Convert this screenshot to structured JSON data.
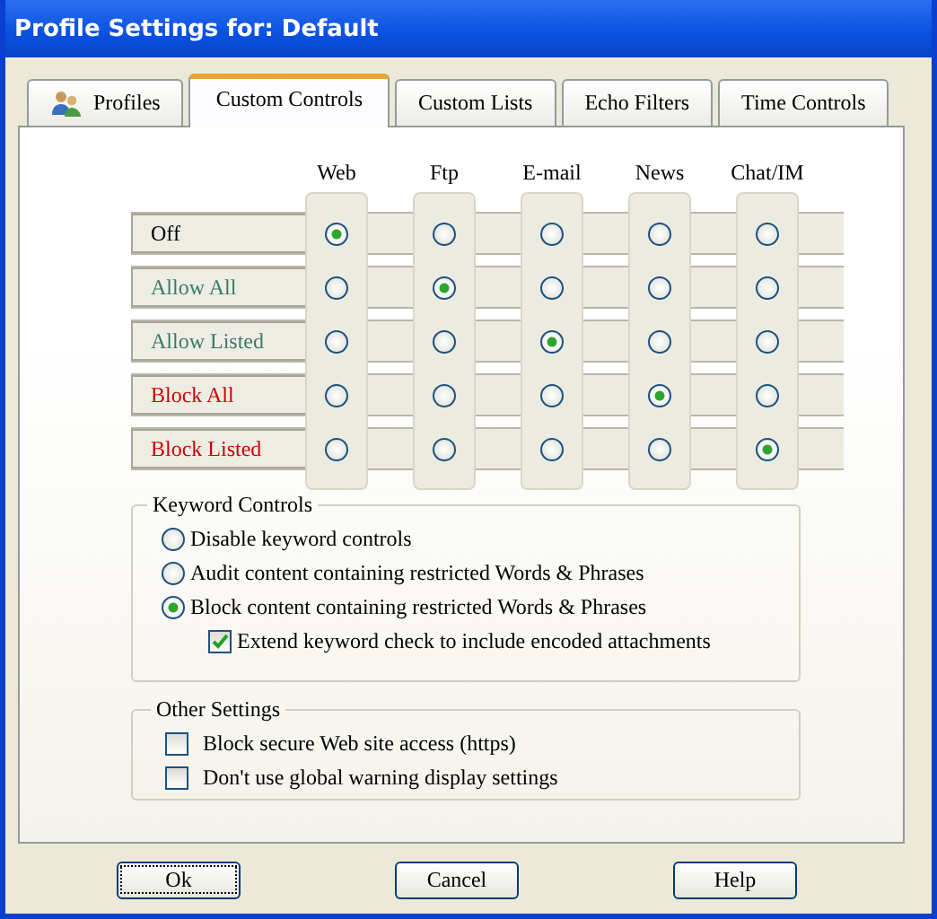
{
  "window": {
    "title": "Profile Settings for: Default"
  },
  "tabs": [
    {
      "label": "Profiles",
      "icon": true,
      "selected": false
    },
    {
      "label": "Custom Controls",
      "icon": false,
      "selected": true
    },
    {
      "label": "Custom Lists",
      "icon": false,
      "selected": false
    },
    {
      "label": "Echo Filters",
      "icon": false,
      "selected": false
    },
    {
      "label": "Time Controls",
      "icon": false,
      "selected": false
    }
  ],
  "columns": [
    "Web",
    "Ftp",
    "E-mail",
    "News",
    "Chat/IM"
  ],
  "rows": [
    {
      "label": "Off",
      "color": "#000000",
      "cells": [
        {
          "selected": true
        },
        {
          "selected": false
        },
        {
          "selected": false
        },
        {
          "selected": false
        },
        {
          "selected": false
        }
      ]
    },
    {
      "label": "Allow All",
      "color": "#3a7a6a",
      "cells": [
        {
          "selected": false
        },
        {
          "selected": true
        },
        {
          "selected": false
        },
        {
          "selected": false
        },
        {
          "selected": false
        }
      ]
    },
    {
      "label": "Allow Listed",
      "color": "#3a7a6a",
      "cells": [
        {
          "selected": false
        },
        {
          "selected": false
        },
        {
          "selected": true
        },
        {
          "selected": false
        },
        {
          "selected": false
        }
      ]
    },
    {
      "label": "Block All",
      "color": "#cc0000",
      "cells": [
        {
          "selected": false
        },
        {
          "selected": false
        },
        {
          "selected": false
        },
        {
          "selected": true
        },
        {
          "selected": false
        }
      ]
    },
    {
      "label": "Block Listed",
      "color": "#cc0000",
      "cells": [
        {
          "selected": false
        },
        {
          "selected": false
        },
        {
          "selected": false
        },
        {
          "selected": false
        },
        {
          "selected": true
        }
      ]
    }
  ],
  "keyword_controls": {
    "title": "Keyword Controls",
    "options": [
      {
        "label": "Disable keyword controls",
        "selected": false
      },
      {
        "label": "Audit content containing restricted Words & Phrases",
        "selected": false
      },
      {
        "label": "Block content containing restricted Words & Phrases",
        "selected": true
      }
    ],
    "extend": {
      "label": "Extend keyword check to include encoded attachments",
      "checked": true
    }
  },
  "other_settings": {
    "title": "Other Settings",
    "items": [
      {
        "label": "Block secure Web site access (https)",
        "checked": false
      },
      {
        "label": "Don't use global warning display settings",
        "checked": false
      }
    ]
  },
  "buttons": [
    {
      "label": "Ok",
      "focused": true
    },
    {
      "label": "Cancel",
      "focused": false
    },
    {
      "label": "Help",
      "focused": false
    }
  ]
}
